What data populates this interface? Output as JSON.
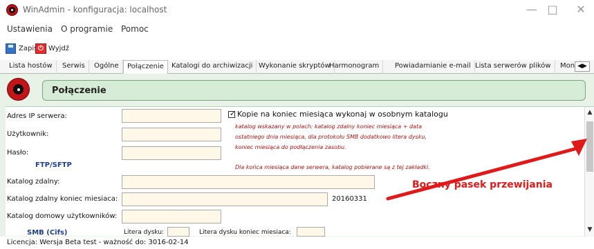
{
  "window": {
    "title": "WinAdmin - konfiguracja: localhost",
    "minimize": "—",
    "maximize": "□",
    "close": "✕"
  },
  "menu": {
    "items": [
      "Ustawienia",
      "O programie",
      "Pomoc"
    ]
  },
  "toolbar": {
    "save_label": "Zapisz",
    "exit_label": "Wyjdź",
    "exit_icon": "⏻"
  },
  "tabs": [
    "Lista hostów",
    "Serwis",
    "Ogólne",
    "Połączenie",
    "Katalogi do archiwizacji",
    "Wykonanie skryptów",
    "Harmonogram",
    "Powiadamianie e-mail",
    "Lista serwerów plików",
    "Moni"
  ],
  "active_tab": "Połączenie",
  "header": {
    "title": "Połączenie"
  },
  "form": {
    "server_ip_label": "Adres IP serwera:",
    "user_label": "Użytkownik:",
    "password_label": "Hasło:",
    "ftp_label": "FTP/SFTP",
    "remote_dir_label": "Katalog zdalny:",
    "remote_dir_end_label": "Katalog zdalny koniec miesiaca:",
    "remote_dir_end_value": "20160331",
    "home_dir_label": "Katalog domowy użytkowników:",
    "smb_label": "SMB (Cifs)",
    "drive_letter_label": "Litera dysku:",
    "drive_letter_end_label": "Litera dysku koniec miesiaca:"
  },
  "checkbox": {
    "label": "Kopie na koniec miesiąca wykonaj w osobnym katalogu",
    "checked": true
  },
  "notes": [
    "katalog wskazany w polach: katalog zdalny koniec miesiąca + data",
    "ostatniego dnia miesiąca, dla protokołu SMB dodatkowo litera dysku,",
    "koniec miesiąca do podłączenia zasobu.",
    "Dla końca miesiąca dane serwera, katalog pobierane są z tej zakładki."
  ],
  "annotation": {
    "text": "Boczny pasek przewijania"
  },
  "status": {
    "text": "Licencja: Wersja Beta test - ważność do: 3016-02-14"
  },
  "colors": {
    "accent": "#e01a1a",
    "header_bg": "#d7ecd6",
    "input_bg": "#fff8e8"
  }
}
